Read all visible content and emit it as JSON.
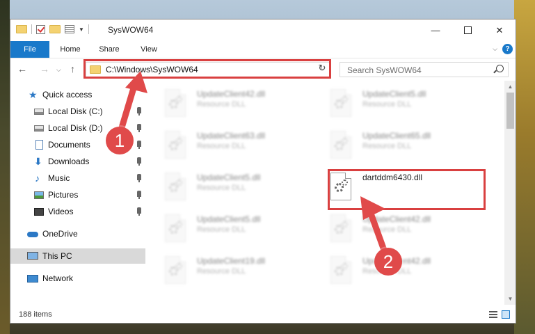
{
  "window": {
    "title": "SysWOW64",
    "controls": {
      "minimize": "—",
      "maximize": "",
      "close": "✕"
    }
  },
  "ribbon": {
    "tabs": [
      {
        "label": "File"
      },
      {
        "label": "Home"
      },
      {
        "label": "Share"
      },
      {
        "label": "View"
      }
    ],
    "help": "?"
  },
  "navigation": {
    "address": "C:\\Windows\\SysWOW64",
    "search_placeholder": "Search SysWOW64"
  },
  "sidebar": {
    "items": [
      {
        "label": "Quick access"
      },
      {
        "label": "Local Disk (C:)"
      },
      {
        "label": "Local Disk (D:)"
      },
      {
        "label": "Documents"
      },
      {
        "label": "Downloads"
      },
      {
        "label": "Music"
      },
      {
        "label": "Pictures"
      },
      {
        "label": "Videos"
      },
      {
        "label": "OneDrive"
      },
      {
        "label": "This PC"
      },
      {
        "label": "Network"
      }
    ]
  },
  "files": [
    {
      "name": "UpdateClient42.dll",
      "type": "Resource DLL"
    },
    {
      "name": "UpdateClient5.dll",
      "type": "Resource DLL"
    },
    {
      "name": "UpdateClient63.dll",
      "type": "Resource DLL"
    },
    {
      "name": "UpdateClient65.dll",
      "type": "Resource DLL"
    },
    {
      "name": "UpdateClient5.dll",
      "type": "Resource DLL"
    },
    {
      "name": "dartddm6430.dll",
      "type": ""
    },
    {
      "name": "UpdateClient5.dll",
      "type": "Resource DLL"
    },
    {
      "name": "UpdateClient42.dll",
      "type": "Resource DLL"
    },
    {
      "name": "UpdateClient19.dll",
      "type": "Resource DLL"
    },
    {
      "name": "UpdateClient42.dll",
      "type": "Resource DLL"
    }
  ],
  "status": {
    "item_count": "188 items"
  },
  "annotations": {
    "step1": "1",
    "step2": "2",
    "color": "#e04a4a"
  }
}
